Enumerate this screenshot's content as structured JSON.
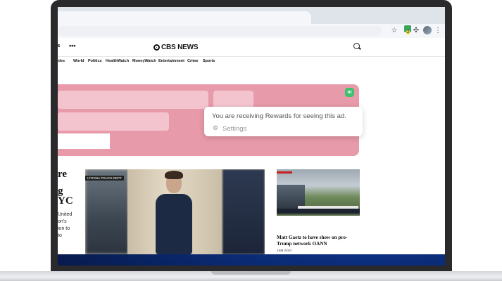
{
  "site": {
    "logo": "CBS NEWS",
    "header_left_label": "ws",
    "more_label": "•••"
  },
  "browser": {
    "ext_badge_count": "2"
  },
  "nav": {
    "items": [
      "cides",
      "World",
      "Politics",
      "HealthWatch",
      "MoneyWatch",
      "Entertainment",
      "Crime",
      "Sports"
    ]
  },
  "ad": {
    "brand_icon_label": "m",
    "rewards_message": "You are receiving Rewards for seeing this ad.",
    "settings_label": "Settings"
  },
  "lead_story": {
    "headline_lines": [
      "re",
      "g",
      "YC"
    ],
    "body_lines": [
      "United",
      "on's",
      "ion to",
      "to"
    ],
    "photo_label": "LTOONA POLICE DEPT"
  },
  "side_story": {
    "headline": "Matt Gaetz to have show on pro-Trump network OANN",
    "timestamp": "10M AGO"
  },
  "icons": [
    "star-icon",
    "extension-icon",
    "puzzle-icon",
    "profile-avatar",
    "kebab-menu-icon",
    "search-icon",
    "gear-icon"
  ]
}
